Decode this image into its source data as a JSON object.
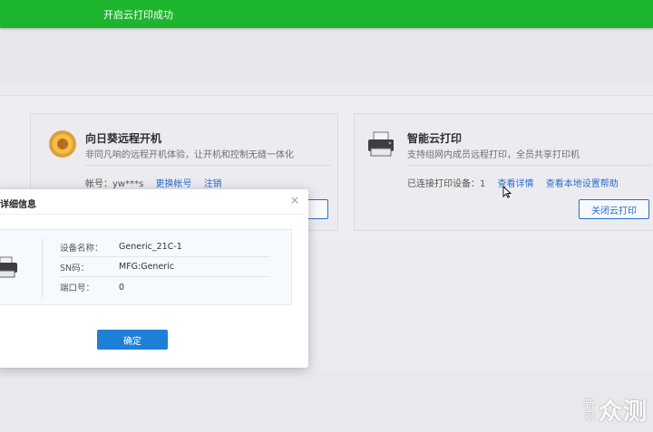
{
  "toast": {
    "message": "开启云打印成功"
  },
  "cards": {
    "remote_boot": {
      "title": "向日葵远程开机",
      "desc": "非同凡响的远程开机体验，让开机和控制无缝一体化",
      "account_label": "帐号：yw***s",
      "change_account": "更换帐号",
      "logout": "注销"
    },
    "cloud_print": {
      "title": "智能云打印",
      "desc": "支持组网内成员远程打印，全员共享打印机",
      "connected_label": "已连接打印设备：1",
      "view_detail": "查看详情",
      "local_help": "查看本地设置帮助",
      "close_button": "关闭云打印"
    }
  },
  "dialog": {
    "title": "详细信息",
    "close_icon": "×",
    "rows": [
      {
        "key": "设备名称：",
        "value": "Generic_21C-1"
      },
      {
        "key": "SN码：",
        "value": "MFG:Generic"
      },
      {
        "key": "端口号：",
        "value": "0"
      }
    ],
    "confirm": "确定"
  },
  "watermark": {
    "small_top": "新",
    "small_bottom": "浪",
    "big": "众测"
  },
  "colors": {
    "toast_bg": "#1eb52e",
    "accent": "#2a6ec8",
    "primary_button": "#1e7fd8"
  }
}
